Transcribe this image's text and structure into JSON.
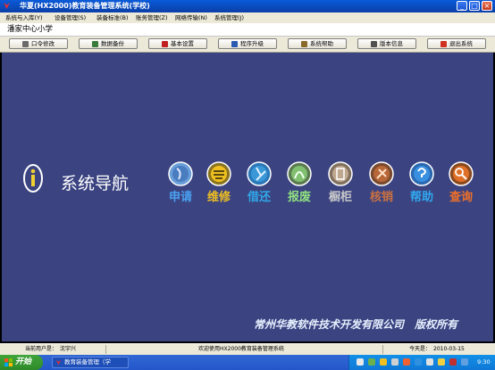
{
  "window": {
    "title": "华夏(HX2000)教育装备管理系统(学校)",
    "controls": {
      "minimize": "_",
      "maximize": "□",
      "close": "×"
    }
  },
  "menu": [
    {
      "label": "系统与入库(Y)"
    },
    {
      "label": "设备管理(S)"
    },
    {
      "label": "装备标准(B)"
    },
    {
      "label": "账务管理(Z)"
    },
    {
      "label": "网络传输(N)"
    },
    {
      "label": "系统管理(J)"
    }
  ],
  "school": {
    "name": "潘家中心小学"
  },
  "toolbar": [
    {
      "label": "口令修改",
      "icon": "key-icon",
      "color": "#6a6a6a"
    },
    {
      "label": "数据备份",
      "icon": "backup-icon",
      "color": "#3a7a3a"
    },
    {
      "label": "基本设置",
      "icon": "settings-icon",
      "color": "#c02020"
    },
    {
      "label": "程序升级",
      "icon": "upgrade-icon",
      "color": "#2a5bb0"
    },
    {
      "label": "系统帮助",
      "icon": "help-icon",
      "color": "#8a6a2a"
    },
    {
      "label": "版本信息",
      "icon": "info-icon",
      "color": "#505050"
    },
    {
      "label": "退出系统",
      "icon": "exit-icon",
      "color": "#d03020"
    }
  ],
  "navigation": {
    "title": "系统导航",
    "items": [
      {
        "label": "申请",
        "icon": "apply-icon",
        "color": "#4aa0f0"
      },
      {
        "label": "维修",
        "icon": "repair-icon",
        "color": "#f0c020"
      },
      {
        "label": "借还",
        "icon": "borrow-return-icon",
        "color": "#30a8e8"
      },
      {
        "label": "报废",
        "icon": "scrap-icon",
        "color": "#90e080"
      },
      {
        "label": "橱柜",
        "icon": "cabinet-icon",
        "color": "#c8c8c8"
      },
      {
        "label": "核销",
        "icon": "writeoff-icon",
        "color": "#c87040"
      },
      {
        "label": "帮助",
        "icon": "help-icon",
        "color": "#30a8f0"
      },
      {
        "label": "查询",
        "icon": "search-icon",
        "color": "#f07028"
      }
    ]
  },
  "copyright": "常州华教软件技术开发有限公司　版权所有",
  "status": {
    "user": "当前用户是：　沈宇兴",
    "welcome": "欢迎使用HX2000教育装备管理系统",
    "today": "今天是：　2010-03-15"
  },
  "taskbar": {
    "start": "开始",
    "task": "教育装备管理（学",
    "clock": "9:30"
  }
}
